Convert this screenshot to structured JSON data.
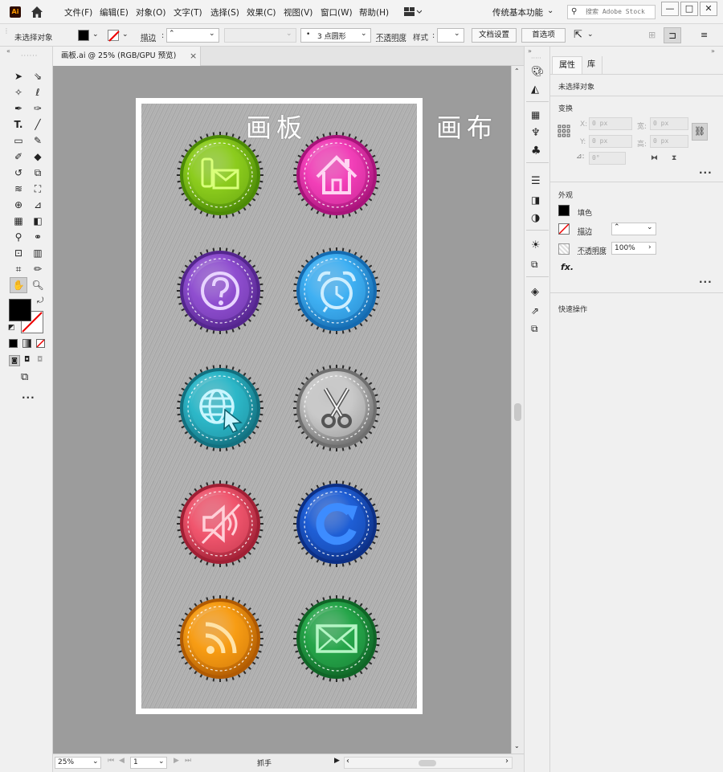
{
  "app": {
    "logo_text": "Ai"
  },
  "menu": [
    "文件(F)",
    "编辑(E)",
    "对象(O)",
    "文字(T)",
    "选择(S)",
    "效果(C)",
    "视图(V)",
    "窗口(W)",
    "帮助(H)"
  ],
  "workspace": {
    "label": "传统基本功能",
    "search_placeholder": "搜索 Adobe Stock"
  },
  "window_controls": {
    "minimize": "—",
    "maximize": "□",
    "close": "✕"
  },
  "control_bar": {
    "selection": "未选择对象",
    "stroke_label": "描边",
    "brush": "3 点圆形",
    "opacity_label": "不透明度",
    "style_label": "样式",
    "doc_setup": "文档设置",
    "preferences": "首选项"
  },
  "document": {
    "tab_title": "画板.ai @ 25% (RGB/GPU 预览)",
    "close": "×"
  },
  "canvas": {
    "artboard_label": "画板",
    "canvas_label": "画布"
  },
  "icons": [
    {
      "name": "phone-mail",
      "color": "#8ccc1e",
      "dark": "#4b8a06",
      "glyph": "#d9ff7a"
    },
    {
      "name": "home",
      "color": "#f23fb8",
      "dark": "#a8137a",
      "glyph": "#ffd4f2"
    },
    {
      "name": "help",
      "color": "#8f4fd0",
      "dark": "#54258e",
      "glyph": "#e8d4ff"
    },
    {
      "name": "alarm-clock",
      "color": "#3fb0f3",
      "dark": "#146ab0",
      "glyph": "#cdeeff"
    },
    {
      "name": "web-cursor",
      "color": "#2db8c9",
      "dark": "#12707f",
      "glyph": "#c9f6ff"
    },
    {
      "name": "scissors",
      "color": "#c8c8c8",
      "dark": "#6e6e6e",
      "glyph": "#f6f6f6"
    },
    {
      "name": "mute",
      "color": "#f0566e",
      "dark": "#a01f34",
      "glyph": "#ffd0d8"
    },
    {
      "name": "refresh",
      "color": "#1f5fd6",
      "dark": "#0c2f85",
      "glyph": "#3d8cff"
    },
    {
      "name": "rss",
      "color": "#f79d14",
      "dark": "#b05a02",
      "glyph": "#ffe3a8"
    },
    {
      "name": "mail",
      "color": "#26a64a",
      "dark": "#0f6526",
      "glyph": "#b4f5c4"
    }
  ],
  "status_bar": {
    "zoom": "25%",
    "artboard_num": "1",
    "tool": "抓手"
  },
  "panel": {
    "tabs": [
      "属性",
      "库"
    ],
    "no_selection": "未选择对象",
    "transform_title": "变换",
    "x_label": "X:",
    "y_label": "Y:",
    "w_label": "宽:",
    "h_label": "高:",
    "x_value": "0 px",
    "y_value": "0 px",
    "w_value": "0 px",
    "h_value": "0 px",
    "angle_value": "0°",
    "appearance_title": "外观",
    "fill_label": "填色",
    "stroke_label": "描边",
    "opacity_label": "不透明度",
    "opacity_value": "100%",
    "fx_label": "fx.",
    "quick_actions": "快速操作"
  }
}
